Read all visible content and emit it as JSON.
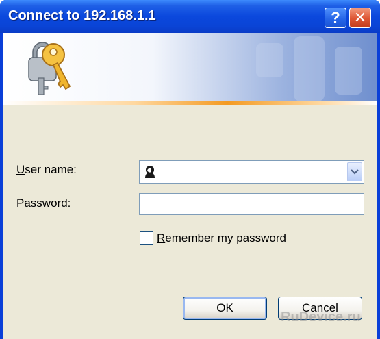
{
  "window": {
    "title": "Connect to 192.168.1.1",
    "help_glyph": "?",
    "close_glyph": "✕"
  },
  "form": {
    "username_label": "User name:",
    "username_access_key": "U",
    "username_label_rest": "ser name:",
    "username_value": "",
    "password_label": "Password:",
    "password_access_key": "P",
    "password_label_rest": "assword:",
    "password_value": "",
    "remember_label": "Remember my password",
    "remember_access_key": "R",
    "remember_label_rest": "emember my password",
    "remember_checked": false
  },
  "buttons": {
    "ok_label": "OK",
    "cancel_label": "Cancel"
  },
  "icons": {
    "banner": "keys-icon",
    "username": "user-icon",
    "combo": "chevron-down-icon"
  },
  "colors": {
    "titlebar": "#0a44d6",
    "dialog_bg": "#ece9d8",
    "accent_line": "#f39a22",
    "close_button": "#dd5533"
  },
  "watermark": "RuDevice.ru"
}
